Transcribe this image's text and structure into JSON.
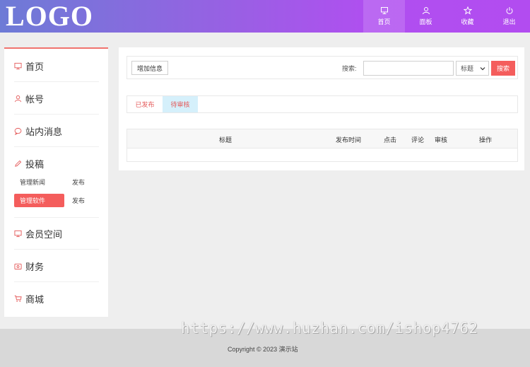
{
  "header": {
    "logo": "LOGO",
    "nav": [
      {
        "label": "首页",
        "icon": "monitor-icon",
        "active": true
      },
      {
        "label": "面板",
        "icon": "user-icon",
        "active": false
      },
      {
        "label": "收藏",
        "icon": "star-icon",
        "active": false
      },
      {
        "label": "退出",
        "icon": "power-icon",
        "active": false
      }
    ]
  },
  "sidebar": {
    "items": [
      {
        "label": "首页",
        "icon": "monitor-icon"
      },
      {
        "label": "帐号",
        "icon": "user-icon"
      },
      {
        "label": "站内消息",
        "icon": "message-icon"
      },
      {
        "label": "投稿",
        "icon": "pencil-icon"
      },
      {
        "label": "会员空间",
        "icon": "monitor-icon"
      },
      {
        "label": "财务",
        "icon": "wallet-icon"
      },
      {
        "label": "商城",
        "icon": "cart-icon"
      }
    ],
    "sub": [
      {
        "left": "管理新闻",
        "right": "发布",
        "active": false
      },
      {
        "left": "管理软件",
        "right": "发布",
        "active": true
      }
    ]
  },
  "toolbar": {
    "add_label": "增加信息",
    "search_label": "搜索:",
    "search_value": "",
    "select_value": "标题",
    "search_button": "搜索"
  },
  "tabs": [
    {
      "label": "已发布",
      "active": false
    },
    {
      "label": "待审核",
      "active": true
    }
  ],
  "table": {
    "headers": [
      "标题",
      "发布时间",
      "点击",
      "评论",
      "审核",
      "操作"
    ]
  },
  "footer": {
    "copyright": "Copyright © 2023 演示站"
  },
  "watermark": "https://www.huzhan.com/ishop4762",
  "colors": {
    "accent": "#f45d5c",
    "pending_tab": "#d5f0fb",
    "header_start": "#6d7bd6",
    "header_end": "#b24cf0"
  }
}
